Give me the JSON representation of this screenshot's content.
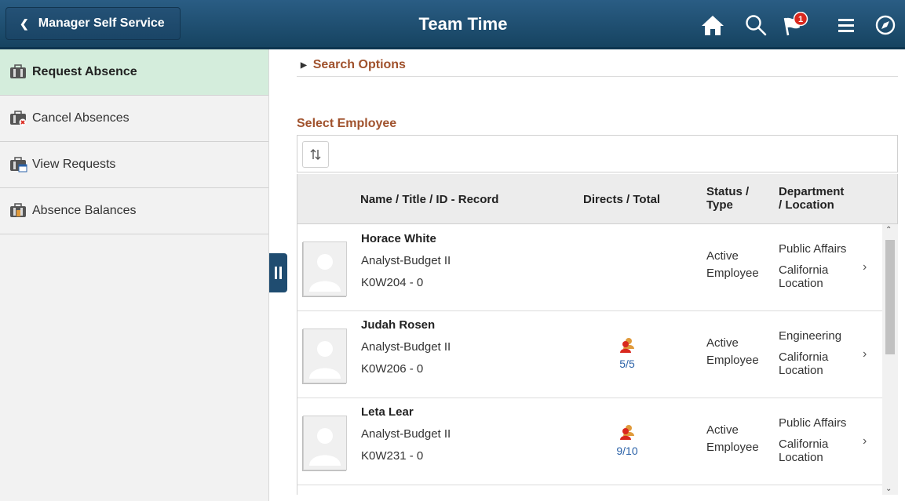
{
  "header": {
    "back_label": "Manager Self Service",
    "title": "Team Time",
    "notification_count": "1",
    "icons": [
      "home-icon",
      "search-icon",
      "notification-flag-icon",
      "menu-icon",
      "navbar-compass-icon"
    ]
  },
  "sidebar": {
    "items": [
      {
        "label": "Request Absence",
        "icon": "absence-request-icon",
        "active": true
      },
      {
        "label": "Cancel Absences",
        "icon": "absence-cancel-icon",
        "active": false
      },
      {
        "label": "View Requests",
        "icon": "absence-calendar-icon",
        "active": false
      },
      {
        "label": "Absence Balances",
        "icon": "absence-balance-icon",
        "active": false
      }
    ]
  },
  "main": {
    "search_options": "Search Options",
    "section_title": "Select Employee",
    "columns": {
      "name": "Name / Title / ID - Record",
      "directs": "Directs / Total",
      "status_l1": "Status /",
      "status_l2": "Type",
      "dept_l1": "Department",
      "dept_l2": "/ Location"
    },
    "rows": [
      {
        "name": "Horace White",
        "title": "Analyst-Budget II",
        "id": "K0W204 - 0",
        "directs": "",
        "status": "Active",
        "type": "Employee",
        "department": "Public Affairs",
        "location_l1": "California",
        "location_l2": "Location"
      },
      {
        "name": "Judah Rosen",
        "title": "Analyst-Budget II",
        "id": "K0W206 - 0",
        "directs": "5/5",
        "status": "Active",
        "type": "Employee",
        "department": "Engineering",
        "location_l1": "California",
        "location_l2": "Location"
      },
      {
        "name": "Leta Lear",
        "title": "Analyst-Budget II",
        "id": "K0W231 - 0",
        "directs": "9/10",
        "status": "Active",
        "type": "Employee",
        "department": "Public Affairs",
        "location_l1": "California",
        "location_l2": "Location"
      }
    ]
  },
  "colors": {
    "header": "#1f4c70",
    "accent_text": "#a0522d",
    "active_nav": "#d4eddc",
    "link": "#2b62a8",
    "badge": "#d9281e"
  }
}
